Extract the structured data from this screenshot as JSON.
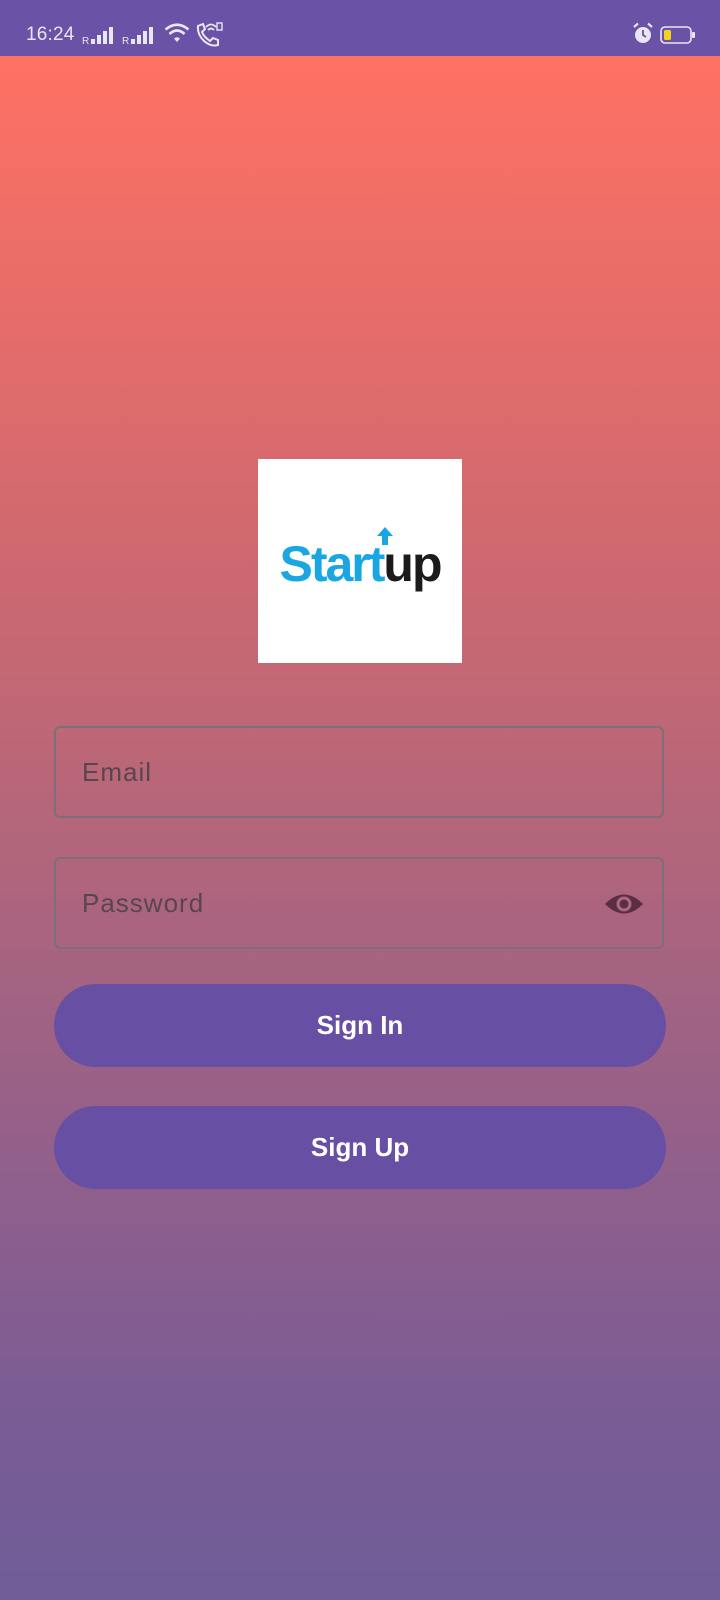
{
  "status_bar": {
    "time": "16:24",
    "signal_icons": [
      "signal-icon",
      "signal-icon"
    ],
    "icons": [
      "wifi-icon",
      "wifi-call-icon",
      "alarm-icon",
      "battery-icon"
    ],
    "color": "#6a52a6"
  },
  "logo": {
    "part1": "Start",
    "part2": "up",
    "color_primary": "#1aa7e1",
    "color_secondary": "#1b1b1b"
  },
  "form": {
    "email_placeholder": "Email",
    "email_value": "",
    "password_placeholder": "Password",
    "password_value": "",
    "password_toggle_icon": "eye-icon"
  },
  "buttons": {
    "sign_in": "Sign In",
    "sign_up": "Sign Up",
    "color": "#6750a4"
  },
  "background": {
    "gradient_top": "#ff7163",
    "gradient_bottom": "#6f5d98"
  }
}
